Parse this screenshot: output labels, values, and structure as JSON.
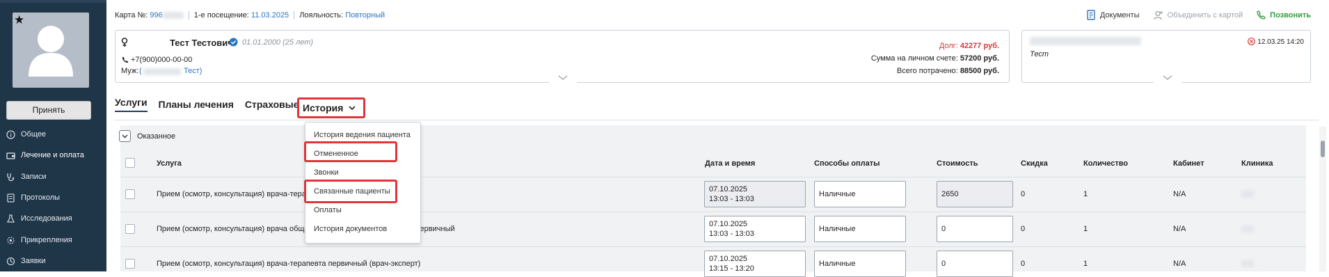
{
  "sidebar": {
    "accept_button": "Принять",
    "items": [
      {
        "label": "Общее",
        "icon": "info-icon"
      },
      {
        "label": "Лечение и оплата",
        "icon": "wallet-icon"
      },
      {
        "label": "Записи",
        "icon": "stethoscope-icon"
      },
      {
        "label": "Протоколы",
        "icon": "document-icon"
      },
      {
        "label": "Исследования",
        "icon": "flask-icon"
      },
      {
        "label": "Прикрепления",
        "icon": "gear-icon"
      },
      {
        "label": "Заявки",
        "icon": "link-icon"
      }
    ]
  },
  "infobar": {
    "card_label": "Карта №:",
    "card_number": "996",
    "first_visit_label": "1-е посещение:",
    "first_visit_date": "11.03.2025",
    "loyalty_label": "Лояльность:",
    "loyalty_value": "Повторный"
  },
  "actions": {
    "documents": "Документы",
    "merge": "Объединить с картой",
    "call": "Позвонить"
  },
  "patient": {
    "name": "Тест Тестович",
    "dob": "01.01.2000 (25 лет)",
    "phone": "+7(900)000-00-00",
    "husband_label": "Муж:",
    "husband_name": "Тест",
    "debt_label": "Долг:",
    "debt_value": "42277 руб.",
    "balance_label": "Сумма на личном счете:",
    "balance_value": "57200 руб.",
    "spent_label": "Всего потрачено:",
    "spent_value": "88500 руб."
  },
  "note": {
    "text": "Тест",
    "timestamp": "12.03.25 14:20"
  },
  "tabs": [
    "Услуги",
    "Планы лечения",
    "Страховые",
    "История"
  ],
  "section_title": "Оказанное",
  "columns": [
    "Услуга",
    "Дата и время",
    "Способы оплаты",
    "Стоимость",
    "Скидка",
    "Количество",
    "Кабинет",
    "Клиника"
  ],
  "rows": [
    {
      "service": "Прием (осмотр, консультация) врача-терапевта первичный",
      "date": "07.10.2025",
      "time": "13:03 - 13:03",
      "payment": "Наличные",
      "cost": "2650",
      "discount": "0",
      "qty": "1",
      "room": "N/A"
    },
    {
      "service": "Прием (осмотр, консультация) врача общей практики (семейного врача) первичный",
      "date": "07.10.2025",
      "time": "13:03 - 13:03",
      "payment": "Наличные",
      "cost": "0",
      "discount": "0",
      "qty": "1",
      "room": "N/A"
    },
    {
      "service": "Прием (осмотр, консультация) врача-терапевта первичный (врач-эксперт)",
      "date": "07.10.2025",
      "time": "13:15 - 13:20",
      "payment": "Наличные",
      "cost": "0",
      "discount": "0",
      "qty": "1",
      "room": "N/A"
    }
  ],
  "dropdown": [
    "История ведения пациента",
    "Отмененное",
    "Звонки",
    "Связанные пациенты",
    "Оплаты",
    "История документов"
  ],
  "colors": {
    "sidebar": "#1f3548",
    "link": "#2a75c0",
    "debt": "#d33b3b",
    "highlight": "#e2343a",
    "call": "#2f9e3a"
  }
}
